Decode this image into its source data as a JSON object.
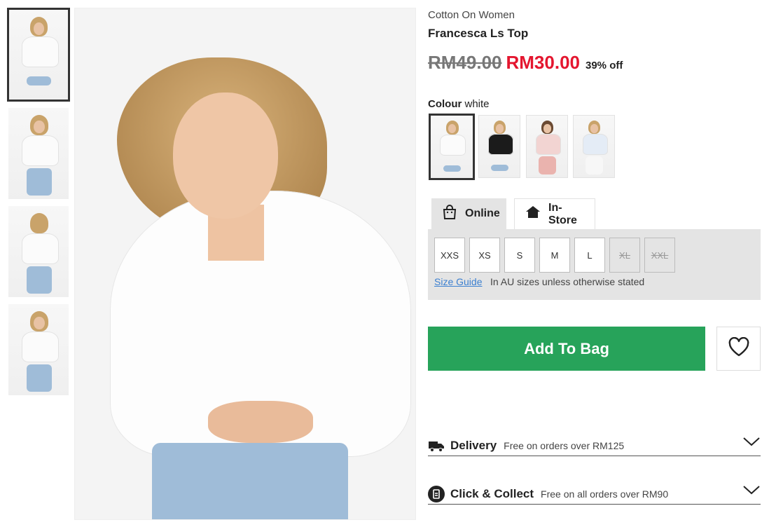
{
  "thumbnails": [
    {
      "name": "thumbnail-1",
      "active": true
    },
    {
      "name": "thumbnail-2",
      "active": false
    },
    {
      "name": "thumbnail-3",
      "active": false
    },
    {
      "name": "thumbnail-4",
      "active": false
    }
  ],
  "product": {
    "brand": "Cotton On Women",
    "name": "Francesca Ls Top",
    "old_price": "RM49.00",
    "new_price": "RM30.00",
    "discount": "39% off"
  },
  "colour": {
    "label": "Colour",
    "selected": "white",
    "swatches": [
      "white",
      "black",
      "pink",
      "light blue"
    ]
  },
  "tabs": {
    "online": "Online",
    "instore": "In-Store"
  },
  "sizes": {
    "options": [
      {
        "label": "XXS",
        "available": true
      },
      {
        "label": "XS",
        "available": true
      },
      {
        "label": "S",
        "available": true
      },
      {
        "label": "M",
        "available": true
      },
      {
        "label": "L",
        "available": true
      },
      {
        "label": "XL",
        "available": false
      },
      {
        "label": "XXL",
        "available": false
      }
    ],
    "guide_label": "Size Guide",
    "note": "In AU sizes unless otherwise stated"
  },
  "actions": {
    "add_to_bag": "Add To Bag"
  },
  "delivery": {
    "title": "Delivery",
    "subtitle": "Free on orders over RM125"
  },
  "click_collect": {
    "title": "Click & Collect",
    "subtitle": "Free on all orders over RM90"
  },
  "colors": {
    "sale_red": "#e4162f",
    "add_green": "#27a35a",
    "panel_grey": "#e4e4e4"
  }
}
